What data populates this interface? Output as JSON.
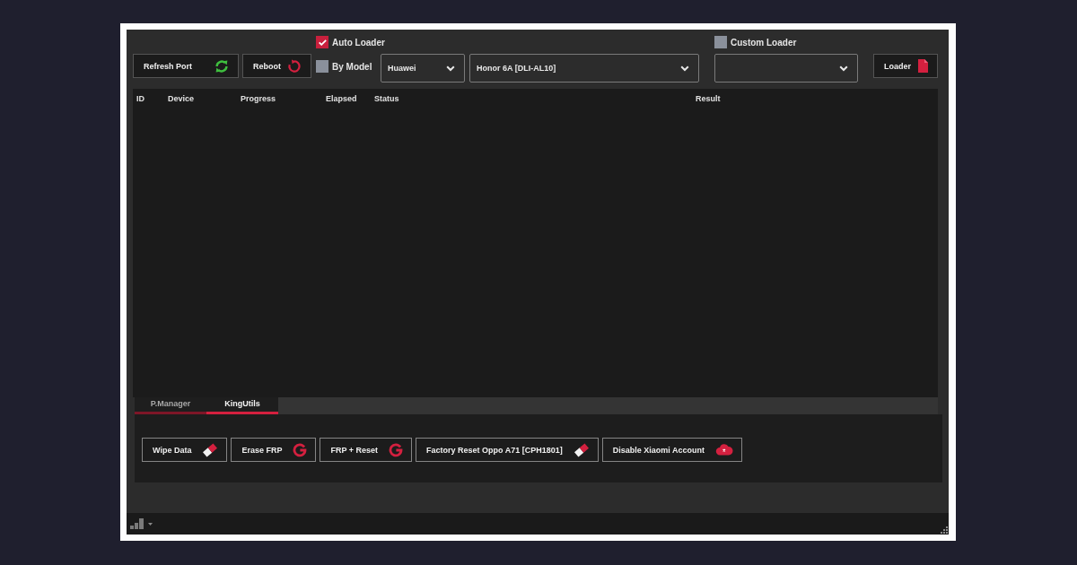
{
  "toolbar": {
    "auto_loader": {
      "label": "Auto Loader",
      "checked": true
    },
    "custom_loader": {
      "label": "Custom Loader",
      "checked": false
    },
    "refresh_button": {
      "label": "Refresh Port"
    },
    "reboot_button": {
      "label": "Reboot"
    },
    "by_model": {
      "label": "By Model",
      "checked": false
    },
    "brand_dropdown": {
      "value": "Huawei"
    },
    "model_dropdown": {
      "value": "Honor 6A [DLI-AL10]"
    },
    "loader_button": {
      "label": "Loader"
    }
  },
  "table": {
    "columns": [
      "ID",
      "Device",
      "Progress",
      "Elapsed",
      "Status",
      "Result"
    ]
  },
  "tabs": [
    {
      "label": "P.Manager",
      "selected": false
    },
    {
      "label": "KingUtils",
      "selected": true
    }
  ],
  "actions": [
    {
      "label": "Wipe Data",
      "kind": "eraser"
    },
    {
      "label": "Erase FRP",
      "kind": "g"
    },
    {
      "label": "FRP + Reset",
      "kind": "g"
    },
    {
      "label": "Factory Reset Oppo A71 [CPH1801]",
      "kind": "eraser"
    },
    {
      "label": "Disable Xiaomi Account",
      "kind": "cloud"
    }
  ]
}
